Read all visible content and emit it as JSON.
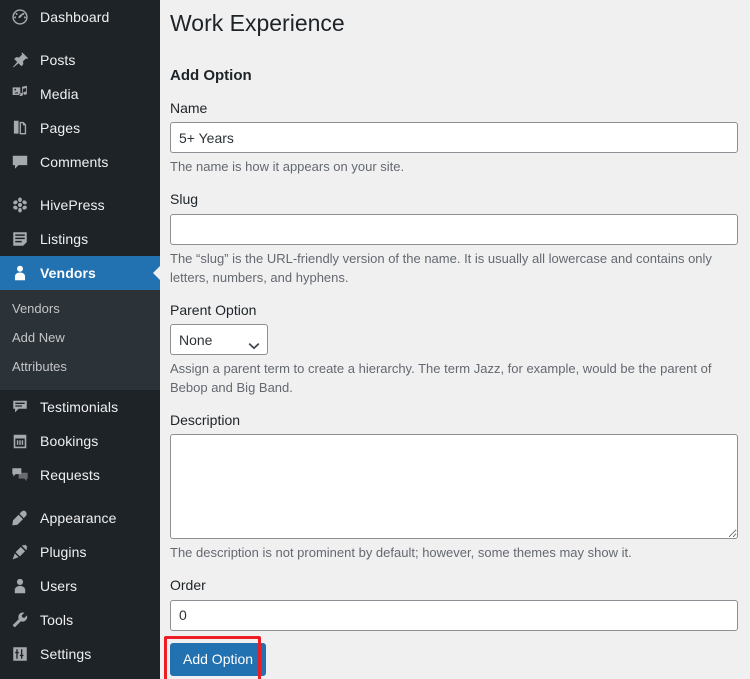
{
  "sidebar": {
    "groups": [
      {
        "items": [
          {
            "label": "Dashboard",
            "icon": "dashboard-icon",
            "name": "sidebar-item-dashboard",
            "current": false
          }
        ]
      },
      {
        "items": [
          {
            "label": "Posts",
            "icon": "pin-icon",
            "name": "sidebar-item-posts",
            "current": false
          },
          {
            "label": "Media",
            "icon": "media-icon",
            "name": "sidebar-item-media",
            "current": false
          },
          {
            "label": "Pages",
            "icon": "pages-icon",
            "name": "sidebar-item-pages",
            "current": false
          },
          {
            "label": "Comments",
            "icon": "comment-icon",
            "name": "sidebar-item-comments",
            "current": false
          }
        ]
      },
      {
        "items": [
          {
            "label": "HivePress",
            "icon": "hivepress-icon",
            "name": "sidebar-item-hivepress",
            "current": false
          },
          {
            "label": "Listings",
            "icon": "listings-icon",
            "name": "sidebar-item-listings",
            "current": false
          },
          {
            "label": "Vendors",
            "icon": "user-icon",
            "name": "sidebar-item-vendors",
            "current": true
          }
        ]
      }
    ],
    "submenu": {
      "items": [
        {
          "label": "Vendors",
          "name": "submenu-item-vendors"
        },
        {
          "label": "Add New",
          "name": "submenu-item-add-new"
        },
        {
          "label": "Attributes",
          "name": "submenu-item-attributes"
        }
      ]
    },
    "groups_after": [
      {
        "items": [
          {
            "label": "Testimonials",
            "icon": "testimonials-icon",
            "name": "sidebar-item-testimonials",
            "current": false
          },
          {
            "label": "Bookings",
            "icon": "calendar-icon",
            "name": "sidebar-item-bookings",
            "current": false
          },
          {
            "label": "Requests",
            "icon": "requests-icon",
            "name": "sidebar-item-requests",
            "current": false
          }
        ]
      },
      {
        "items": [
          {
            "label": "Appearance",
            "icon": "brush-icon",
            "name": "sidebar-item-appearance",
            "current": false
          },
          {
            "label": "Plugins",
            "icon": "plug-icon",
            "name": "sidebar-item-plugins",
            "current": false
          },
          {
            "label": "Users",
            "icon": "users-icon",
            "name": "sidebar-item-users",
            "current": false
          },
          {
            "label": "Tools",
            "icon": "wrench-icon",
            "name": "sidebar-item-tools",
            "current": false
          },
          {
            "label": "Settings",
            "icon": "sliders-icon",
            "name": "sidebar-item-settings",
            "current": false
          }
        ]
      }
    ]
  },
  "main": {
    "page_title": "Work Experience",
    "section_title": "Add Option",
    "fields": {
      "name": {
        "label": "Name",
        "value": "5+ Years",
        "placeholder": "",
        "help": "The name is how it appears on your site."
      },
      "slug": {
        "label": "Slug",
        "value": "",
        "placeholder": "",
        "help": "The “slug” is the URL-friendly version of the name. It is usually all lowercase and contains only letters, numbers, and hyphens."
      },
      "parent": {
        "label": "Parent Option",
        "value": "None",
        "options": [
          "None"
        ],
        "help": "Assign a parent term to create a hierarchy. The term Jazz, for example, would be the parent of Bebop and Big Band."
      },
      "description": {
        "label": "Description",
        "value": "",
        "placeholder": "",
        "help": "The description is not prominent by default; however, some themes may show it."
      },
      "order": {
        "label": "Order",
        "value": "0",
        "placeholder": ""
      }
    },
    "submit_label": "Add Option"
  },
  "colors": {
    "sidebar_bg": "#1d2327",
    "submenu_bg": "#2c3338",
    "accent_blue": "#2271b1",
    "page_bg": "#f0f0f1",
    "annotation_red": "#ee1c25",
    "help_text": "#646970"
  }
}
